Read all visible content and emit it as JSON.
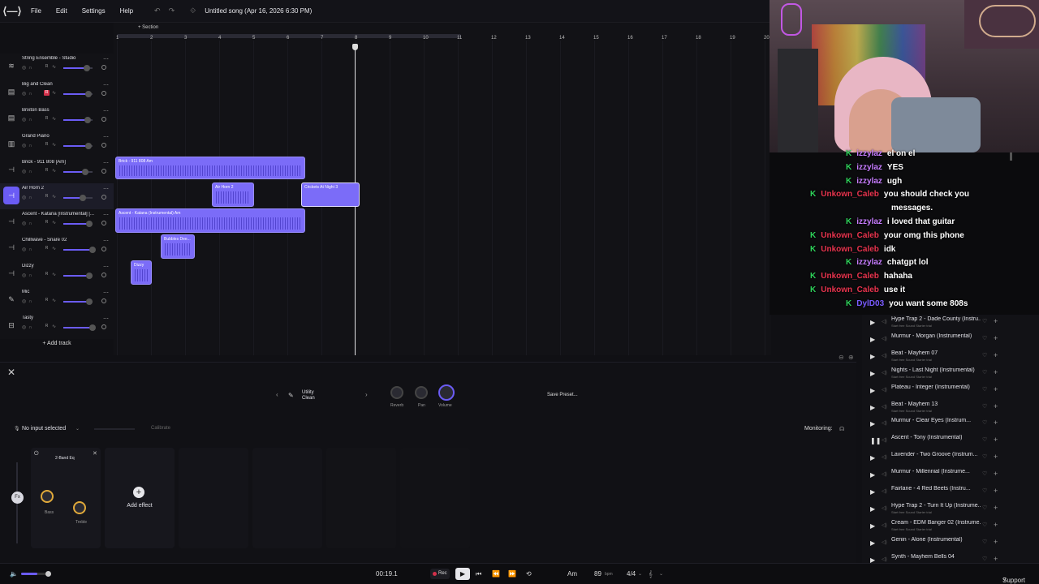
{
  "topbar": {
    "logo": "⟨—⟩",
    "menu": [
      "File",
      "Edit",
      "Settings",
      "Help"
    ],
    "song_title": "Untitled song (Apr 16, 2026 6:30 PM)"
  },
  "timeline": {
    "section_label": "+ Section",
    "ruler": [
      "1",
      "2",
      "3",
      "4",
      "5",
      "6",
      "7",
      "8",
      "9",
      "10",
      "11",
      "12",
      "13",
      "14",
      "15",
      "16",
      "17",
      "18",
      "19",
      "20"
    ]
  },
  "tracks": [
    {
      "name": "String Ensemble - Studio",
      "icon": "piano-icon",
      "r_active": false,
      "level": 0.75
    },
    {
      "name": "Big and Clean",
      "icon": "amp-icon",
      "r_active": true,
      "level": 0.8
    },
    {
      "name": "Brixton Bass",
      "icon": "amp-icon",
      "r_active": false,
      "level": 0.78
    },
    {
      "name": "Grand Piano",
      "icon": "keys-icon",
      "r_active": false,
      "level": 0.8
    },
    {
      "name": "Brick - 911 808 [Am]",
      "icon": "beat-icon",
      "r_active": false,
      "level": 0.7
    },
    {
      "name": "Air Horn 2",
      "icon": "beat-icon",
      "r_active": false,
      "level": 0.6,
      "selected": true
    },
    {
      "name": "Ascent - Katana [Instrumental] [...",
      "icon": "beat-icon",
      "r_active": false,
      "level": 0.82
    },
    {
      "name": "Chillwave - Snare 02",
      "icon": "beat-icon",
      "r_active": false,
      "level": 0.95
    },
    {
      "name": "Dizzy",
      "icon": "beat-icon",
      "r_active": false,
      "level": 0.82
    },
    {
      "name": "Mic",
      "icon": "mic-icon",
      "r_active": false,
      "level": 0.82
    },
    {
      "name": "Tasty",
      "icon": "loop-icon",
      "r_active": false,
      "level": 0.95
    }
  ],
  "add_track": "+ Add track",
  "clips": [
    {
      "name": "Brick - 911 808 Am"
    },
    {
      "name": "Air Horn 2"
    },
    {
      "name": "Crickets At Night 3"
    },
    {
      "name": "Ascent - Katana (Instrumental) Am"
    },
    {
      "name": "Bubbles Dee..."
    },
    {
      "name": "Dizzy"
    }
  ],
  "instrument": {
    "preset_line1": "Utility",
    "preset_line2": "Clean",
    "knob_labels": [
      "Reverb",
      "Pan",
      "Volume"
    ],
    "save_preset": "Save Preset..."
  },
  "input": {
    "no_input": "No input selected",
    "calibrate": "Calibrate",
    "monitoring": "Monitoring:"
  },
  "effects": {
    "eq_title": "2-Band Eq",
    "knob_labels": [
      "Bass",
      "Treble"
    ],
    "fx_label": "Fx",
    "add_effect": "Add effect"
  },
  "transport": {
    "time": "00:19.1",
    "rec": "Rec",
    "key": "Am",
    "bpm": "89",
    "bpm_unit": "bpm",
    "time_sig": "4/4",
    "support": "Support"
  },
  "chat": [
    {
      "user": "izzylaz",
      "color": "#c77dff",
      "msg": "el on el"
    },
    {
      "user": "izzylaz",
      "color": "#c77dff",
      "msg": "YES"
    },
    {
      "user": "izzylaz",
      "color": "#c77dff",
      "msg": "ugh"
    },
    {
      "user": "Unkown_Caleb",
      "color": "#e8344e",
      "msg": "you should check you"
    },
    {
      "user": "",
      "color": "#e8344e",
      "msg": "messages."
    },
    {
      "user": "izzylaz",
      "color": "#c77dff",
      "msg": "i loved that guitar"
    },
    {
      "user": "Unkown_Caleb",
      "color": "#e8344e",
      "msg": "your omg this phone"
    },
    {
      "user": "Unkown_Caleb",
      "color": "#e8344e",
      "msg": "idk"
    },
    {
      "user": "izzylaz",
      "color": "#c77dff",
      "msg": "chatgpt lol"
    },
    {
      "user": "Unkown_Caleb",
      "color": "#e8344e",
      "msg": "hahaha"
    },
    {
      "user": "Unkown_Caleb",
      "color": "#e8344e",
      "msg": "use it"
    },
    {
      "user": "DylD03",
      "color": "#7a5cff",
      "msg": "you want some 808s"
    }
  ],
  "sounds": [
    {
      "title": "Hype Trap 2 - Dade County (Instru...",
      "sub": "Start free Sound Starter trial"
    },
    {
      "title": "Murmur - Morgan (Instrumental)",
      "sub": ""
    },
    {
      "title": "Beat - Mayhem 07",
      "sub": "Start free Sound Starter trial"
    },
    {
      "title": "Nights - Last Night (Instrumental)",
      "sub": "Start free Sound Starter trial"
    },
    {
      "title": "Plateau - Integer (Instrumental)",
      "sub": ""
    },
    {
      "title": "Beat - Mayhem 13",
      "sub": "Start free Sound Starter trial"
    },
    {
      "title": "Murmur - Clear Eyes (Instrum...",
      "sub": ""
    },
    {
      "title": "Ascent - Tony (Instrumental)",
      "sub": ""
    },
    {
      "title": "Lavender - Two Groove (Instrum...",
      "sub": ""
    },
    {
      "title": "Murmur - Millennial (Instrume...",
      "sub": ""
    },
    {
      "title": "Fairlane - 4 Red Beets (Instru...",
      "sub": ""
    },
    {
      "title": "Hype Trap 2 - Turn It Up (Instrume...",
      "sub": "Start free Sound Starter trial"
    },
    {
      "title": "Cream - EDM Banger 02 (Instrume...",
      "sub": "Start free Sound Starter trial"
    },
    {
      "title": "Genin - Alone (Instrumental)",
      "sub": ""
    },
    {
      "title": "Synth - Mayhem Bells 04",
      "sub": ""
    }
  ],
  "colors": {
    "accent": "#6b5cf5",
    "clip": "#7b6cf8",
    "rec": "#d3304a",
    "chat_k": "#2ed35a"
  }
}
